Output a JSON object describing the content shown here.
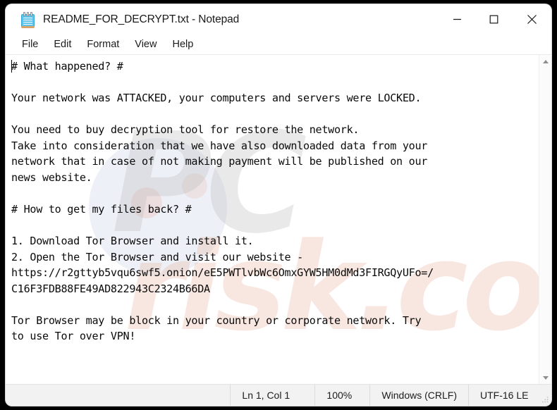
{
  "window": {
    "title": "README_FOR_DECRYPT.txt - Notepad",
    "icon": "notepad-icon",
    "controls": {
      "minimize": "minimize-button",
      "maximize": "maximize-button",
      "close": "close-button"
    }
  },
  "menubar": {
    "items": [
      {
        "label": "File"
      },
      {
        "label": "Edit"
      },
      {
        "label": "Format"
      },
      {
        "label": "View"
      },
      {
        "label": "Help"
      }
    ]
  },
  "document": {
    "lines": [
      "# What happened? #",
      "",
      "Your network was ATTACKED, your computers and servers were LOCKED.",
      "",
      "You need to buy decryption tool for restore the network.",
      "Take into consideration that we have also downloaded data from your",
      "network that in case of not making payment will be published on our",
      "news website.",
      "",
      "# How to get my files back? #",
      "",
      "1. Download Tor Browser and install it.",
      "2. Open the Tor Browser and visit our website -",
      "https://r2gttyb5vqu6swf5.onion/eE5PWTlvbWc6OmxGYW5HM0dMd3FIRGQyUFo=/",
      "C16F3FDB88FE49AD822943C2324B66DA",
      "",
      "Tor Browser may be block in your country or corporate network. Try",
      "to use Tor over VPN!"
    ]
  },
  "watermark": {
    "line1": "PC",
    "line2": "risk.com"
  },
  "scrollbar": {
    "up": "scroll-up-arrow",
    "down": "scroll-down-arrow"
  },
  "statusbar": {
    "cursor": "Ln 1, Col 1",
    "zoom": "100%",
    "line_ending": "Windows (CRLF)",
    "encoding": "UTF-16 LE"
  },
  "colors": {
    "window_bg": "#ffffff",
    "desktop_bg": "#000000",
    "statusbar_bg": "#f2f2f2",
    "icon_blue": "#5fc2e8",
    "text": "#0a0a0a"
  }
}
